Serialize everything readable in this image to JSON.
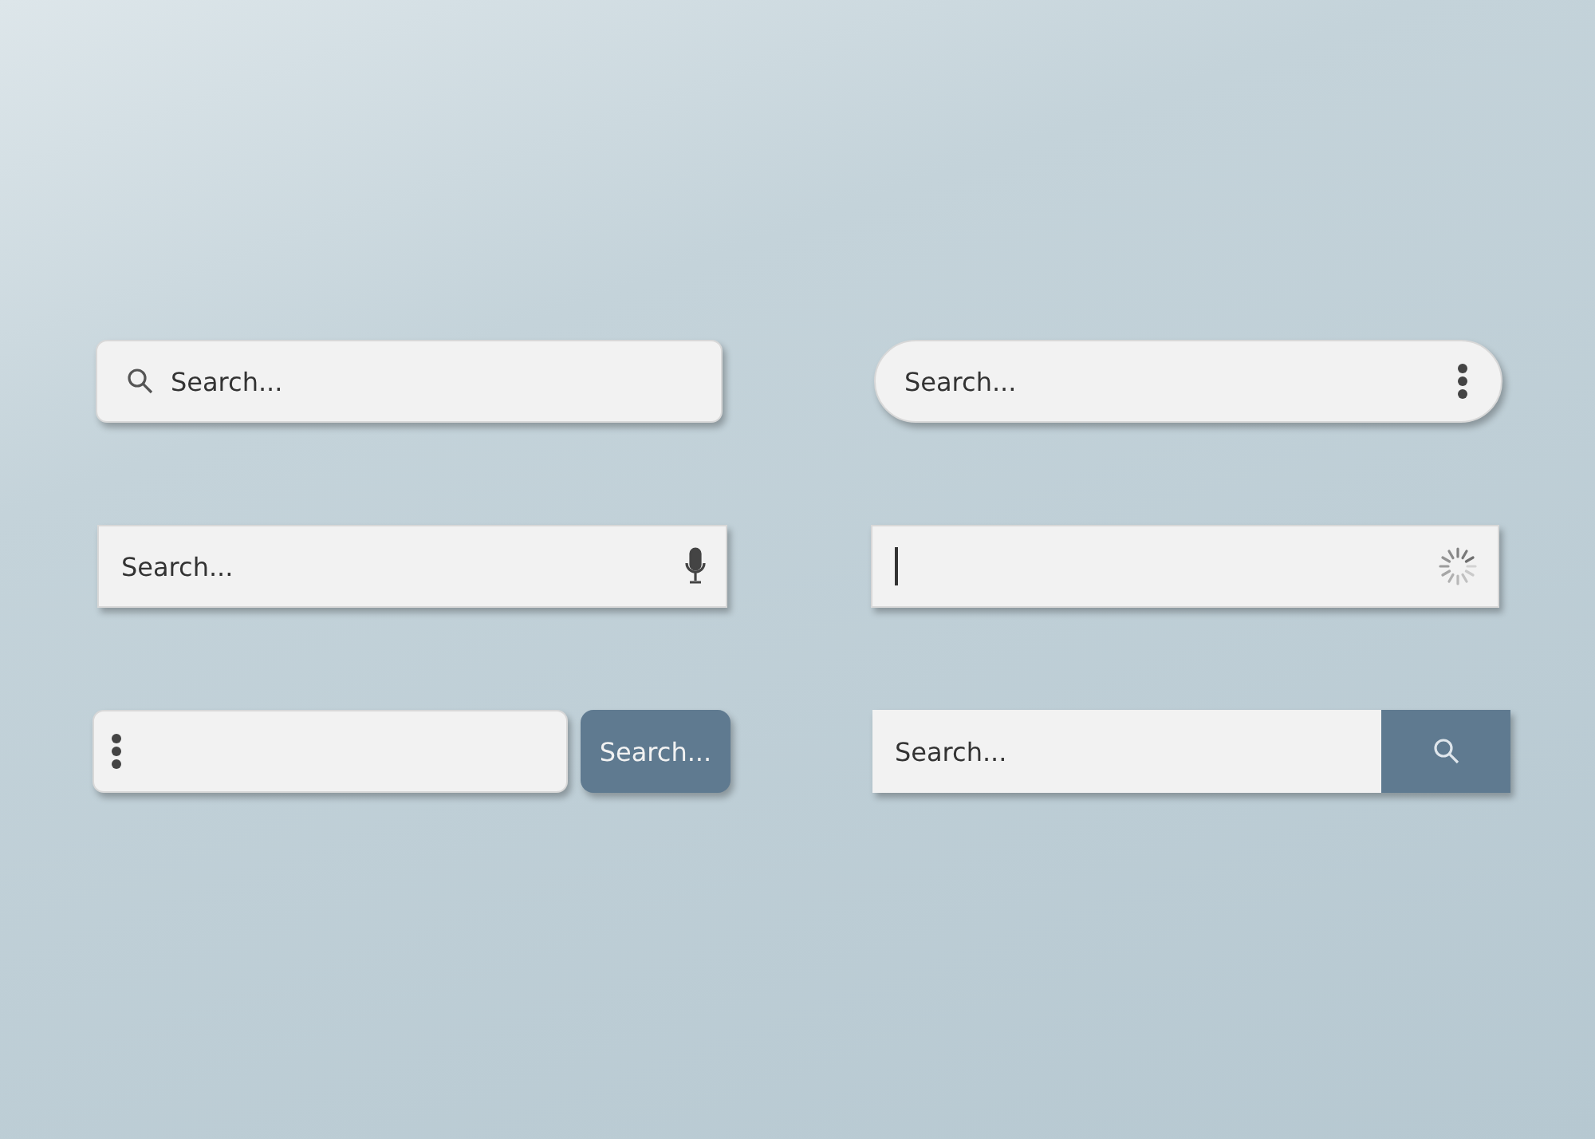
{
  "search_bars": [
    {
      "kind": "icon-left",
      "placeholder": "Search..."
    },
    {
      "kind": "pill-menu",
      "placeholder": "Search..."
    },
    {
      "kind": "voice",
      "placeholder": "Search..."
    },
    {
      "kind": "loading",
      "focused": true
    },
    {
      "kind": "menu-button",
      "button_label": "Search..."
    },
    {
      "kind": "icon-button",
      "placeholder": "Search..."
    }
  ]
}
